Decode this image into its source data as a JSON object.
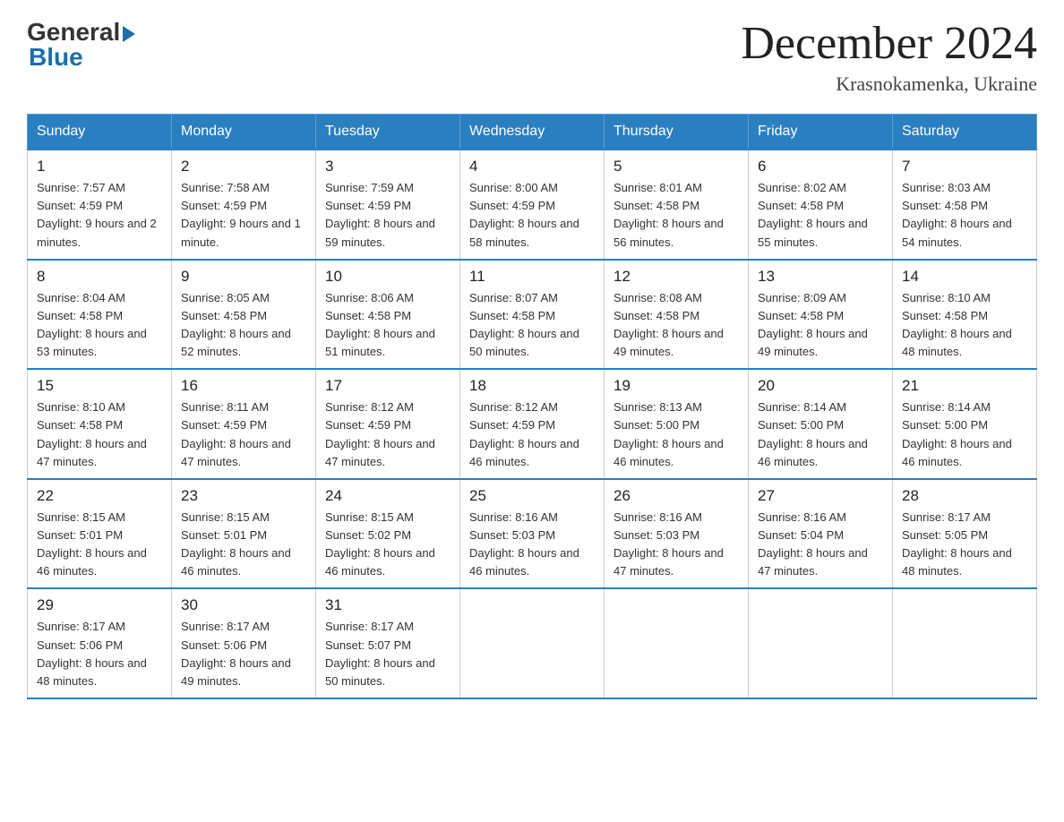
{
  "header": {
    "logo_general": "General",
    "logo_blue": "Blue",
    "month_title": "December 2024",
    "location": "Krasnokamenka, Ukraine"
  },
  "calendar": {
    "days_of_week": [
      "Sunday",
      "Monday",
      "Tuesday",
      "Wednesday",
      "Thursday",
      "Friday",
      "Saturday"
    ],
    "weeks": [
      [
        {
          "day": "1",
          "sunrise": "7:57 AM",
          "sunset": "4:59 PM",
          "daylight": "9 hours and 2 minutes."
        },
        {
          "day": "2",
          "sunrise": "7:58 AM",
          "sunset": "4:59 PM",
          "daylight": "9 hours and 1 minute."
        },
        {
          "day": "3",
          "sunrise": "7:59 AM",
          "sunset": "4:59 PM",
          "daylight": "8 hours and 59 minutes."
        },
        {
          "day": "4",
          "sunrise": "8:00 AM",
          "sunset": "4:59 PM",
          "daylight": "8 hours and 58 minutes."
        },
        {
          "day": "5",
          "sunrise": "8:01 AM",
          "sunset": "4:58 PM",
          "daylight": "8 hours and 56 minutes."
        },
        {
          "day": "6",
          "sunrise": "8:02 AM",
          "sunset": "4:58 PM",
          "daylight": "8 hours and 55 minutes."
        },
        {
          "day": "7",
          "sunrise": "8:03 AM",
          "sunset": "4:58 PM",
          "daylight": "8 hours and 54 minutes."
        }
      ],
      [
        {
          "day": "8",
          "sunrise": "8:04 AM",
          "sunset": "4:58 PM",
          "daylight": "8 hours and 53 minutes."
        },
        {
          "day": "9",
          "sunrise": "8:05 AM",
          "sunset": "4:58 PM",
          "daylight": "8 hours and 52 minutes."
        },
        {
          "day": "10",
          "sunrise": "8:06 AM",
          "sunset": "4:58 PM",
          "daylight": "8 hours and 51 minutes."
        },
        {
          "day": "11",
          "sunrise": "8:07 AM",
          "sunset": "4:58 PM",
          "daylight": "8 hours and 50 minutes."
        },
        {
          "day": "12",
          "sunrise": "8:08 AM",
          "sunset": "4:58 PM",
          "daylight": "8 hours and 49 minutes."
        },
        {
          "day": "13",
          "sunrise": "8:09 AM",
          "sunset": "4:58 PM",
          "daylight": "8 hours and 49 minutes."
        },
        {
          "day": "14",
          "sunrise": "8:10 AM",
          "sunset": "4:58 PM",
          "daylight": "8 hours and 48 minutes."
        }
      ],
      [
        {
          "day": "15",
          "sunrise": "8:10 AM",
          "sunset": "4:58 PM",
          "daylight": "8 hours and 47 minutes."
        },
        {
          "day": "16",
          "sunrise": "8:11 AM",
          "sunset": "4:59 PM",
          "daylight": "8 hours and 47 minutes."
        },
        {
          "day": "17",
          "sunrise": "8:12 AM",
          "sunset": "4:59 PM",
          "daylight": "8 hours and 47 minutes."
        },
        {
          "day": "18",
          "sunrise": "8:12 AM",
          "sunset": "4:59 PM",
          "daylight": "8 hours and 46 minutes."
        },
        {
          "day": "19",
          "sunrise": "8:13 AM",
          "sunset": "5:00 PM",
          "daylight": "8 hours and 46 minutes."
        },
        {
          "day": "20",
          "sunrise": "8:14 AM",
          "sunset": "5:00 PM",
          "daylight": "8 hours and 46 minutes."
        },
        {
          "day": "21",
          "sunrise": "8:14 AM",
          "sunset": "5:00 PM",
          "daylight": "8 hours and 46 minutes."
        }
      ],
      [
        {
          "day": "22",
          "sunrise": "8:15 AM",
          "sunset": "5:01 PM",
          "daylight": "8 hours and 46 minutes."
        },
        {
          "day": "23",
          "sunrise": "8:15 AM",
          "sunset": "5:01 PM",
          "daylight": "8 hours and 46 minutes."
        },
        {
          "day": "24",
          "sunrise": "8:15 AM",
          "sunset": "5:02 PM",
          "daylight": "8 hours and 46 minutes."
        },
        {
          "day": "25",
          "sunrise": "8:16 AM",
          "sunset": "5:03 PM",
          "daylight": "8 hours and 46 minutes."
        },
        {
          "day": "26",
          "sunrise": "8:16 AM",
          "sunset": "5:03 PM",
          "daylight": "8 hours and 47 minutes."
        },
        {
          "day": "27",
          "sunrise": "8:16 AM",
          "sunset": "5:04 PM",
          "daylight": "8 hours and 47 minutes."
        },
        {
          "day": "28",
          "sunrise": "8:17 AM",
          "sunset": "5:05 PM",
          "daylight": "8 hours and 48 minutes."
        }
      ],
      [
        {
          "day": "29",
          "sunrise": "8:17 AM",
          "sunset": "5:06 PM",
          "daylight": "8 hours and 48 minutes."
        },
        {
          "day": "30",
          "sunrise": "8:17 AM",
          "sunset": "5:06 PM",
          "daylight": "8 hours and 49 minutes."
        },
        {
          "day": "31",
          "sunrise": "8:17 AM",
          "sunset": "5:07 PM",
          "daylight": "8 hours and 50 minutes."
        },
        null,
        null,
        null,
        null
      ]
    ]
  }
}
